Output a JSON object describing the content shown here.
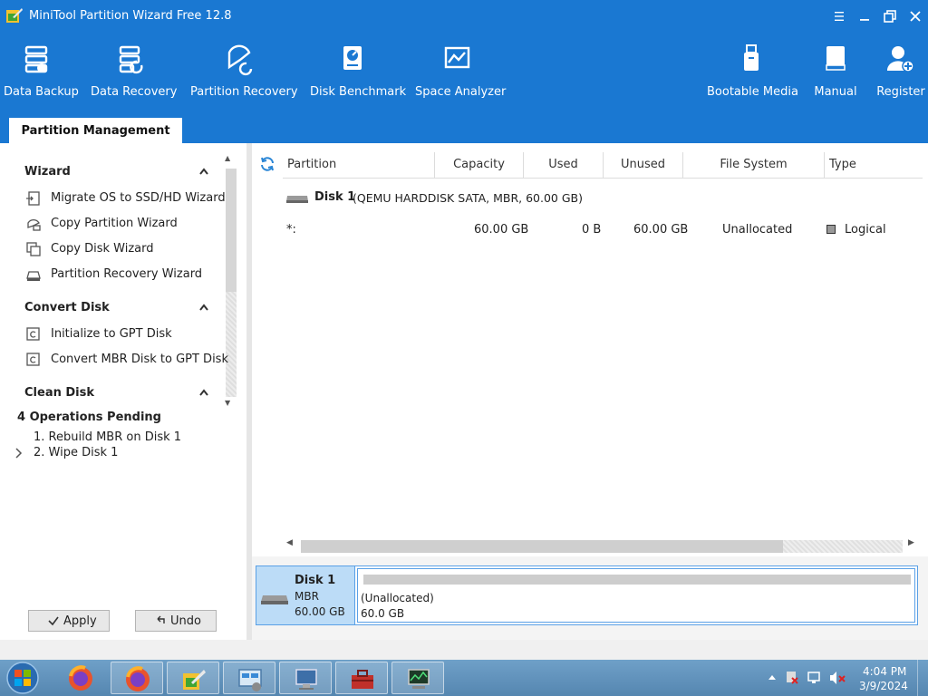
{
  "window": {
    "title": "MiniTool Partition Wizard Free 12.8"
  },
  "toolbar": {
    "data_backup": "Data Backup",
    "data_recovery": "Data Recovery",
    "partition_recovery": "Partition Recovery",
    "disk_benchmark": "Disk Benchmark",
    "space_analyzer": "Space Analyzer",
    "bootable_media": "Bootable Media",
    "manual": "Manual",
    "register": "Register"
  },
  "tabs": {
    "partition_management": "Partition Management"
  },
  "sidebar": {
    "wizard": {
      "title": "Wizard",
      "items": [
        "Migrate OS to SSD/HD Wizard",
        "Copy Partition Wizard",
        "Copy Disk Wizard",
        "Partition Recovery Wizard"
      ]
    },
    "convert_disk": {
      "title": "Convert Disk",
      "items": [
        "Initialize to GPT Disk",
        "Convert MBR Disk to GPT Disk"
      ]
    },
    "clean_disk": {
      "title": "Clean Disk"
    },
    "operations": {
      "title": "4 Operations Pending",
      "items": [
        "1. Rebuild MBR on Disk 1",
        "2. Wipe Disk 1"
      ]
    },
    "apply_label": "Apply",
    "undo_label": "Undo"
  },
  "table": {
    "columns": [
      "Partition",
      "Capacity",
      "Used",
      "Unused",
      "File System",
      "Type"
    ],
    "disk": {
      "name": "Disk 1",
      "desc": "(QEMU HARDDISK SATA, MBR, 60.00 GB)"
    },
    "row": {
      "partition": "*:",
      "capacity": "60.00 GB",
      "used": "0 B",
      "unused": "60.00 GB",
      "file_system": "Unallocated",
      "type": "Logical"
    }
  },
  "diskmap": {
    "name": "Disk 1",
    "type": "MBR",
    "size": "60.00 GB",
    "partition_label": "(Unallocated)",
    "partition_size": "60.0 GB"
  },
  "taskbar": {
    "time": "4:04 PM",
    "date": "3/9/2024"
  },
  "colors": {
    "header_blue": "#1a78d2",
    "selection_blue": "#bcdcf7",
    "border_blue": "#5aa0e6"
  },
  "icons": [
    "app-logo-icon",
    "menu-icon",
    "minimize-icon",
    "restore-icon",
    "close-icon",
    "data-backup-icon",
    "data-recovery-icon",
    "partition-recovery-icon",
    "disk-benchmark-icon",
    "space-analyzer-icon",
    "bootable-media-icon",
    "manual-icon",
    "register-icon",
    "refresh-icon",
    "disk-icon",
    "check-icon",
    "undo-icon",
    "windows-start-icon",
    "firefox-icon",
    "network-icon",
    "volume-muted-icon"
  ]
}
